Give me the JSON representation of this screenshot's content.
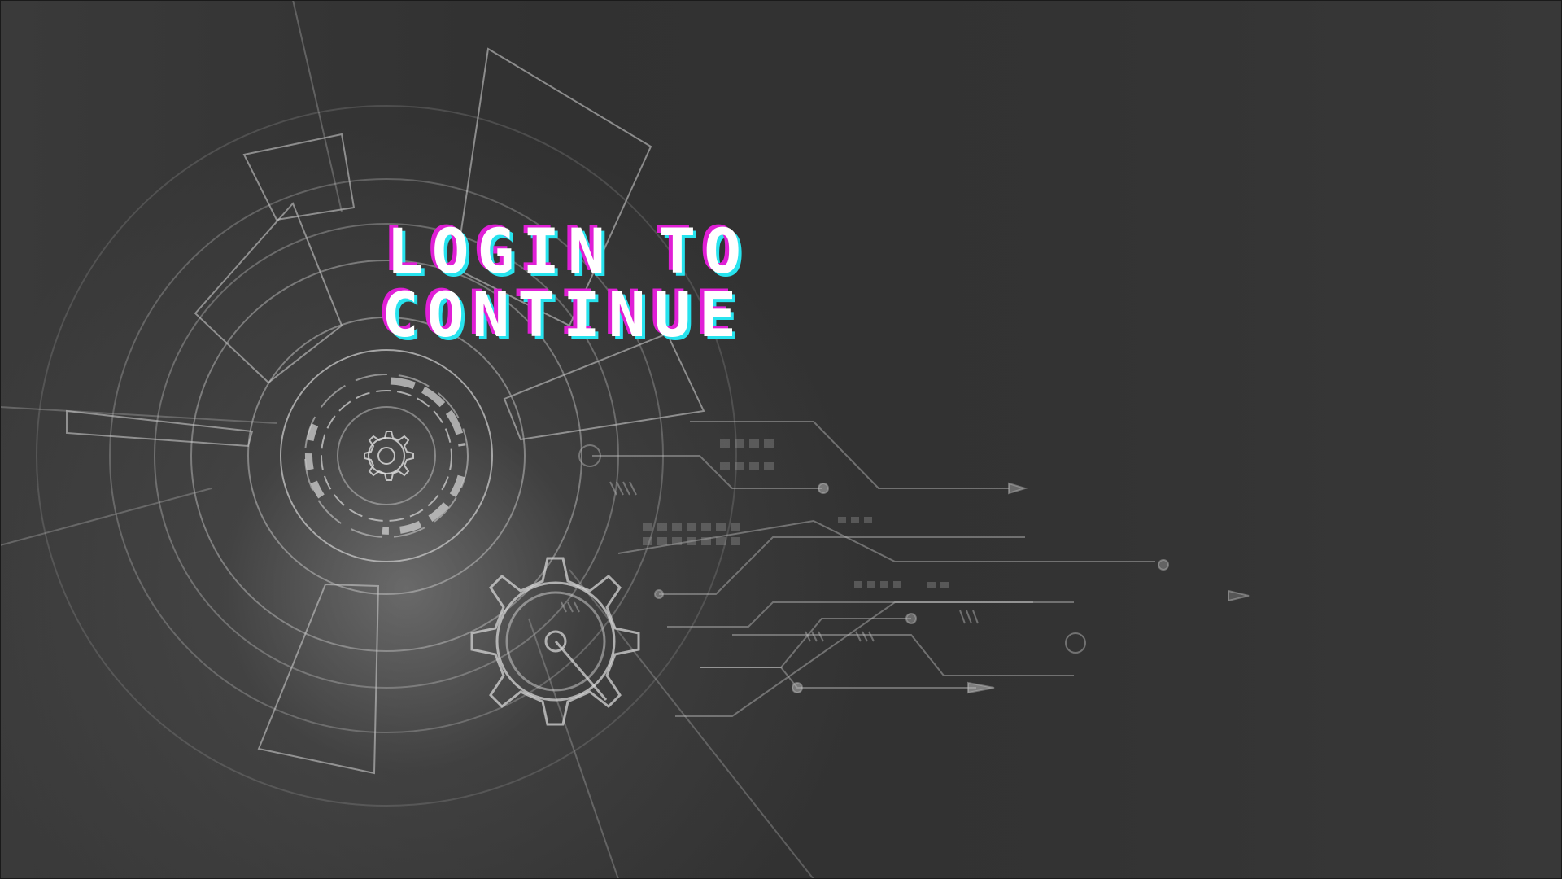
{
  "headline": {
    "line1": "LOGIN TO",
    "line2": "CONTINUE"
  },
  "colors": {
    "background": "#333333",
    "text": "#ffffff",
    "glitch_magenta": "#e01fd6",
    "glitch_cyan": "#27e3ee",
    "line_art": "#bdbdbd"
  },
  "decoration": {
    "icons": [
      "gear-icon",
      "circuit-lines",
      "radar-rings"
    ]
  }
}
